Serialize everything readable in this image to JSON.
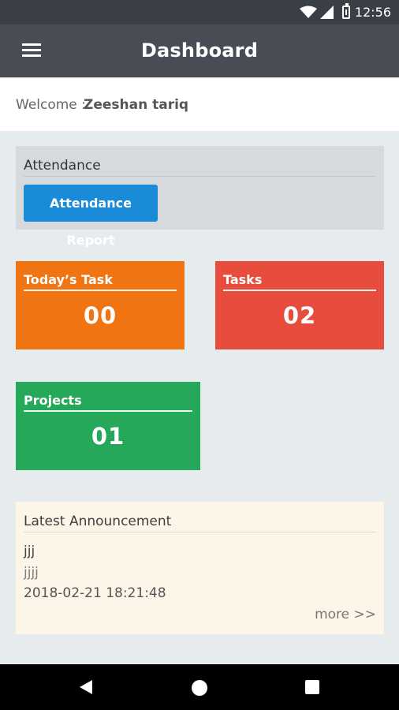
{
  "status_bar": {
    "time": "12:56"
  },
  "app_bar": {
    "title": "Dashboard"
  },
  "welcome": {
    "label": "Welcome :",
    "name": "Zeeshan tariq"
  },
  "attendance": {
    "title": "Attendance",
    "button_label": "Attendance Report"
  },
  "tiles": {
    "todays_task": {
      "title": "Today’s Task",
      "value": "00",
      "color": "#f17412"
    },
    "tasks": {
      "title": "Tasks",
      "value": "02",
      "color": "#e74c3c"
    },
    "projects": {
      "title": "Projects",
      "value": "01",
      "color": "#26a85a"
    }
  },
  "announcement": {
    "title": "Latest Announcement",
    "subject": "jjj",
    "body": "jjjj",
    "datetime": "2018-02-21 18:21:48",
    "more_label": "more >>"
  },
  "colors": {
    "accent": "#1a8bd8",
    "app_bar": "#474c55",
    "status_bar": "#3a3e45"
  },
  "icons": [
    "wifi-icon",
    "signal-icon",
    "battery-icon",
    "menu-icon",
    "back-icon",
    "home-icon",
    "recent-apps-icon"
  ]
}
